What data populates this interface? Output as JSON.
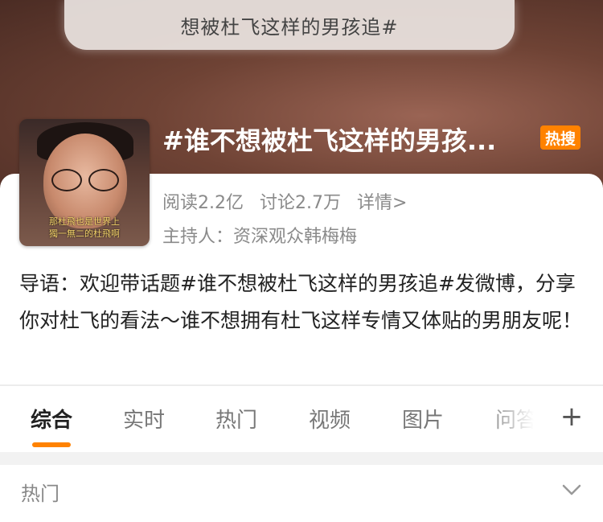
{
  "search": {
    "text": "想被杜飞这样的男孩追#"
  },
  "topic": {
    "title": "#谁不想被杜飞这样的男孩...",
    "badge": "热搜",
    "reads": "阅读2.2亿",
    "discussions": "讨论2.7万",
    "details": "详情>",
    "host": "主持人：资深观众韩梅梅",
    "cover_caption_line1": "那杜飛也是世界上",
    "cover_caption_line2": "獨一無二的杜飛啊",
    "intro": "导语：欢迎带话题#谁不想被杜飞这样的男孩追#发微博，分享你对杜飞的看法～谁不想拥有杜飞这样专情又体贴的男朋友呢！"
  },
  "tabs": [
    {
      "label": "综合",
      "active": true
    },
    {
      "label": "实时"
    },
    {
      "label": "热门"
    },
    {
      "label": "视频"
    },
    {
      "label": "图片"
    },
    {
      "label": "问答"
    }
  ],
  "section": {
    "title": "热门"
  },
  "icons": {
    "add": "plus-icon",
    "expand": "chevron-down-icon"
  },
  "colors": {
    "accent": "#ff8200",
    "text_muted": "#8a8a8a"
  }
}
